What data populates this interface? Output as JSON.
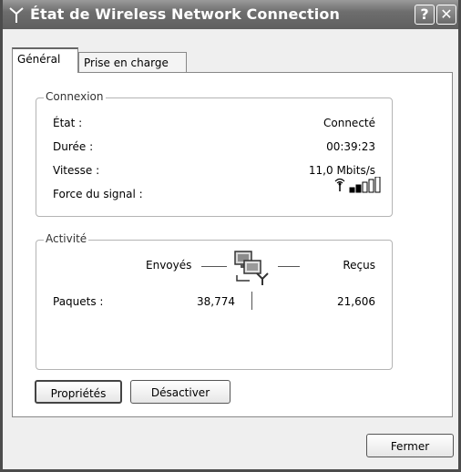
{
  "window": {
    "title": "État de Wireless Network Connection",
    "help_label": "?",
    "close_label": "✕"
  },
  "tabs": [
    {
      "label": "Général",
      "active": true
    },
    {
      "label": "Prise en charge",
      "active": false
    }
  ],
  "connexion": {
    "legend": "Connexion",
    "rows": [
      {
        "label": "État :",
        "value": "Connecté"
      },
      {
        "label": "Durée :",
        "value": "00:39:23"
      },
      {
        "label": "Vitesse :",
        "value": "11,0 Mbits/s"
      },
      {
        "label": "Force du signal :",
        "value": ""
      }
    ],
    "signal_bars_filled": 2,
    "signal_bars_total": 5
  },
  "activite": {
    "legend": "Activité",
    "sent_label": "Envoyés",
    "received_label": "Reçus",
    "packets_label": "Paquets :",
    "packets_sent": "38,774",
    "packets_received": "21,606"
  },
  "buttons": {
    "properties": "Propriétés",
    "disable": "Désactiver",
    "close": "Fermer"
  },
  "icons": {
    "title_icon": "wireless-antenna-icon",
    "network_icon": "network-computers-icon",
    "signal_icon": "signal-strength-icon"
  }
}
